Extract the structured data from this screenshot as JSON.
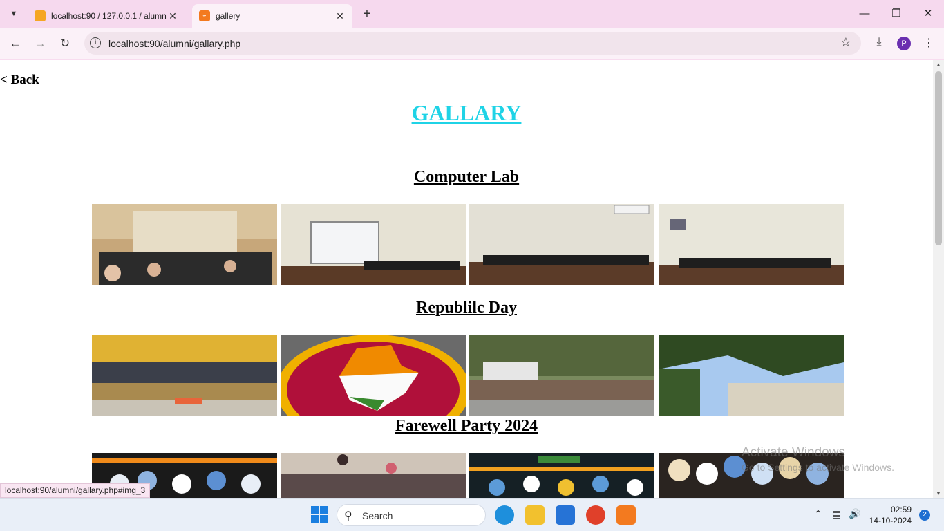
{
  "browser": {
    "tabs": [
      {
        "title": "localhost:90 / 127.0.0.1 / alumni",
        "favicon": "phpmyadmin-icon",
        "active": false
      },
      {
        "title": "gallery",
        "favicon": "xampp-icon",
        "active": true
      }
    ],
    "url": "localhost:90/alumni/gallary.php",
    "profile_initial": "P",
    "status_url": "localhost:90/alumni/gallary.php#img_3"
  },
  "page": {
    "back_label": "< Back",
    "title": "GALLARY",
    "sections": [
      {
        "title": "Computer Lab"
      },
      {
        "title": "Republilc Day"
      },
      {
        "title": "Farewell Party 2024"
      }
    ]
  },
  "watermark": {
    "line1": "Activate Windows",
    "line2": "Go to Settings to activate Windows."
  },
  "taskbar": {
    "search_label": "Search",
    "time": "02:59",
    "date": "14-10-2024",
    "notification_count": "2"
  },
  "colors": {
    "title": "#1fd3e6",
    "chrome": "#f6d9ee",
    "profile": "#6a2fb0"
  }
}
